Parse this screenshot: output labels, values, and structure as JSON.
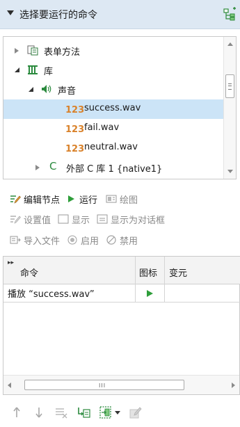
{
  "section": {
    "title": "选择要运行的命令"
  },
  "tree": {
    "items": [
      {
        "label": "表单方法",
        "state": "collapsed",
        "icon": "form-methods-icon"
      },
      {
        "label": "库",
        "state": "expanded",
        "icon": "library-icon"
      },
      {
        "label": "声音",
        "state": "expanded",
        "icon": "speaker-icon"
      },
      {
        "label": "success.wav",
        "badge": "123",
        "selected": true,
        "icon": "number-badge-icon"
      },
      {
        "label": "fail.wav",
        "badge": "123",
        "icon": "number-badge-icon"
      },
      {
        "label": "neutral.wav",
        "badge": "123",
        "icon": "number-badge-icon"
      },
      {
        "label": "外部 C 库 1 {native1}",
        "state": "collapsed",
        "icon": "c-library-icon"
      }
    ]
  },
  "toolbar": {
    "edit_node": "编辑节点",
    "run": "运行",
    "plot": "绘图",
    "set_value": "设置值",
    "show": "显示",
    "show_as_dialog": "显示为对话框",
    "import_file": "导入文件",
    "enable": "启用",
    "disable": "禁用"
  },
  "grid": {
    "headers": {
      "command": "命令",
      "icon": "图标",
      "argument": "变元"
    },
    "rows": [
      {
        "command": "播放 “success.wav”",
        "icon": "play-icon",
        "argument": ""
      }
    ],
    "hscroll_grip": "III"
  },
  "colors": {
    "header_bg": "#dde8f3",
    "selected_row": "#cce4f7",
    "play_green": "#2e9e3a",
    "badge_orange": "#d9822b"
  }
}
